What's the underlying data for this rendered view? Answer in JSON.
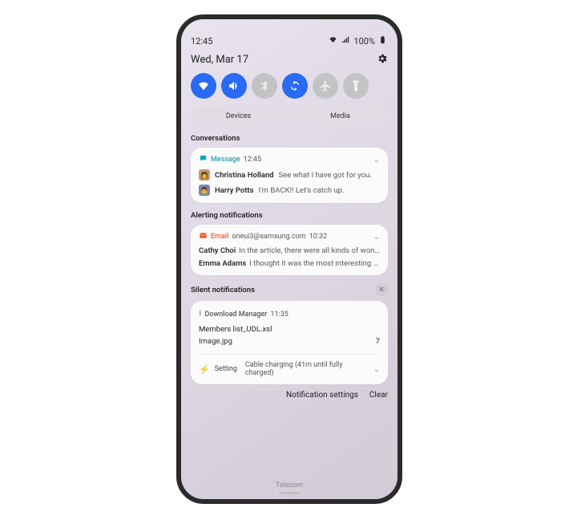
{
  "status": {
    "time": "12:45",
    "battery": "100%"
  },
  "header": {
    "date": "Wed, Mar 17"
  },
  "quick_toggles": [
    {
      "name": "wifi",
      "state": "on"
    },
    {
      "name": "sound",
      "state": "on"
    },
    {
      "name": "bluetooth",
      "state": "off"
    },
    {
      "name": "rotate",
      "state": "on"
    },
    {
      "name": "airplane",
      "state": "off"
    },
    {
      "name": "flashlight",
      "state": "off"
    }
  ],
  "pills": {
    "devices": "Devices",
    "media": "Media"
  },
  "sections": {
    "conversations": {
      "label": "Conversations",
      "card": {
        "app": "Message",
        "time": "12:45",
        "rows": [
          {
            "who": "Christina Holland",
            "msg": "See what I have got for you."
          },
          {
            "who": "Harry Potts",
            "msg": "I'm BACK!! Let's catch up."
          }
        ]
      }
    },
    "alerting": {
      "label": "Alerting notifications",
      "card": {
        "app": "Email",
        "account": "oneui3@samsung.com",
        "time": "10:32",
        "rows": [
          {
            "who": "Cathy Choi",
            "msg": "In the article, there were all kinds of wond…"
          },
          {
            "who": "Emma Adams",
            "msg": "I thought it was the most interesting th…"
          }
        ]
      }
    },
    "silent": {
      "label": "Silent notifications",
      "card": {
        "app": "Download Manager",
        "time": "11:35",
        "file1": "Members list_UDL.xsl",
        "file2": "Image.jpg",
        "count": "7",
        "setting_app": "Setting",
        "setting_text": "Cable charging (41m until fully charged)"
      }
    }
  },
  "footer": {
    "settings": "Notification settings",
    "clear": "Clear"
  },
  "carrier": "Telecom"
}
